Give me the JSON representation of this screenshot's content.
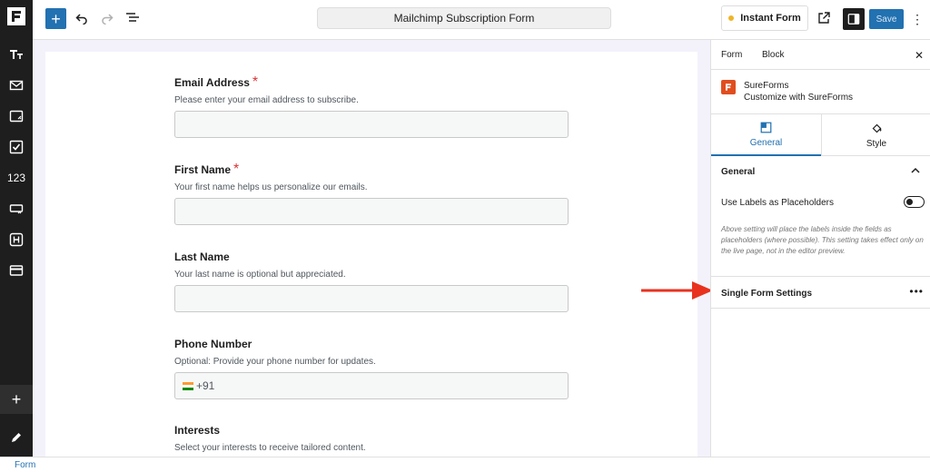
{
  "toolbar": {
    "document_title": "Mailchimp Subscription Form",
    "instant_form_label": "Instant Form",
    "save_label": "Save"
  },
  "rail": {
    "number_label": "123"
  },
  "form": {
    "fields": [
      {
        "label": "Email Address",
        "required": "*",
        "help": "Please enter your email address to subscribe."
      },
      {
        "label": "First Name",
        "required": "*",
        "help": "Your first name helps us personalize our emails."
      },
      {
        "label": "Last Name",
        "required": "",
        "help": "Your last name is optional but appreciated."
      },
      {
        "label": "Phone Number",
        "required": "",
        "help": "Optional: Provide your phone number for updates.",
        "prefix": "+91"
      },
      {
        "label": "Interests",
        "required": "",
        "help": "Select your interests to receive tailored content."
      }
    ]
  },
  "sidebar": {
    "tabs": [
      "Form",
      "Block"
    ],
    "plugin_name": "SureForms",
    "plugin_desc": "Customize with SureForms",
    "subtabs": [
      "General",
      "Style"
    ],
    "section_title": "General",
    "option_label": "Use Labels as Placeholders",
    "option_toggle": "off",
    "option_help": "Above setting will place the labels inside the fields as placeholders (where possible). This setting takes effect only on the live page, not in the editor preview.",
    "single_form_settings": "Single Form Settings"
  },
  "breadcrumb": {
    "label": "Form"
  },
  "colors": {
    "accent": "#2271b1",
    "required": "#d63638",
    "arrow": "#e8321f",
    "brand": "#e04e1f"
  }
}
